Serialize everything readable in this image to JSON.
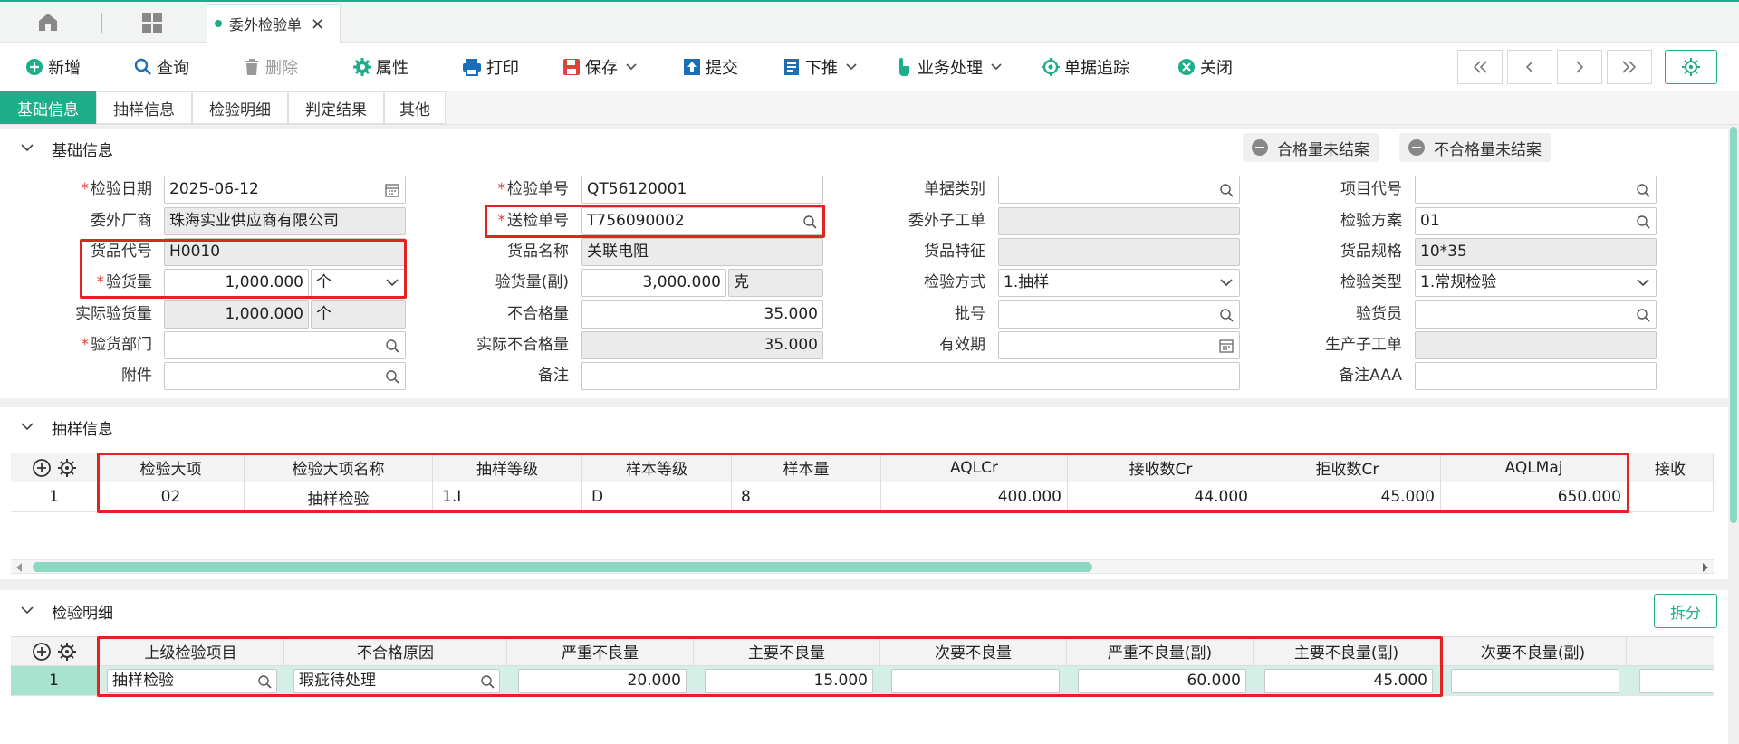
{
  "tabbar": {
    "active_tab": "委外检验单"
  },
  "toolbar": {
    "new": "新增",
    "query": "查询",
    "delete": "删除",
    "property": "属性",
    "print": "打印",
    "save": "保存",
    "submit": "提交",
    "push_down": "下推",
    "business": "业务处理",
    "trace": "单据追踪",
    "close": "关闭"
  },
  "section_tabs": [
    "基础信息",
    "抽样信息",
    "检验明细",
    "判定结果",
    "其他"
  ],
  "basic": {
    "title": "基础信息",
    "pill_qualified": "合格量未结案",
    "pill_unqualified": "不合格量未结案",
    "labels": {
      "insp_date": "检验日期",
      "insp_no": "检验单号",
      "doc_type": "单据类别",
      "project_code": "项目代号",
      "vendor": "委外厂商",
      "send_no": "送检单号",
      "sub_order": "委外子工单",
      "insp_plan": "检验方案",
      "item_code": "货品代号",
      "item_name": "货品名称",
      "item_feature": "货品特征",
      "item_spec": "货品规格",
      "insp_qty": "验货量",
      "insp_qty_sub": "验货量(副)",
      "insp_method": "检验方式",
      "insp_type": "检验类型",
      "actual_qty": "实际验货量",
      "unqual_qty": "不合格量",
      "batch": "批号",
      "inspector": "验货员",
      "insp_dept": "验货部门",
      "actual_unqual": "实际不合格量",
      "valid_period": "有效期",
      "prod_sub_order": "生产子工单",
      "attachment": "附件",
      "remark": "备注",
      "remark_aaa": "备注AAA"
    },
    "values": {
      "insp_date": "2025-06-12",
      "insp_no": "QT56120001",
      "doc_type": "",
      "project_code": "",
      "vendor": "珠海实业供应商有限公司",
      "send_no": "T756090002",
      "sub_order": "",
      "insp_plan": "01",
      "item_code": "H0010",
      "item_name": "关联电阻",
      "item_feature": "",
      "item_spec": "10*35",
      "insp_qty": "1,000.000",
      "insp_unit": "个",
      "insp_qty_sub": "3,000.000",
      "insp_unit_sub": "克",
      "insp_method": "1.抽样",
      "insp_type": "1.常规检验",
      "actual_qty": "1,000.000",
      "actual_unit": "个",
      "unqual_qty": "35.000",
      "batch": "",
      "inspector": "",
      "insp_dept": "",
      "actual_unqual": "35.000",
      "valid_period": "",
      "prod_sub_order": "",
      "attachment": "",
      "remark": "",
      "remark_aaa": ""
    }
  },
  "sampling": {
    "title": "抽样信息",
    "columns": [
      "检验大项",
      "检验大项名称",
      "抽样等级",
      "样本等级",
      "样本量",
      "AQLCr",
      "接收数Cr",
      "拒收数Cr",
      "AQLMaj",
      "接收"
    ],
    "rows": [
      {
        "no": "1",
        "cells": [
          "02",
          "抽样检验",
          "1.I",
          "D",
          "8",
          "400.000",
          "44.000",
          "45.000",
          "650.000",
          ""
        ]
      }
    ]
  },
  "detail": {
    "title": "检验明细",
    "split_label": "拆分",
    "columns": [
      "上级检验项目",
      "不合格原因",
      "严重不良量",
      "主要不良量",
      "次要不良量",
      "严重不良量(副)",
      "主要不良量(副)",
      "次要不良量(副)"
    ],
    "rows": [
      {
        "no": "1",
        "cells": [
          "抽样检验",
          "瑕疵待处理",
          "20.000",
          "15.000",
          "",
          "60.000",
          "45.000",
          ""
        ]
      }
    ]
  },
  "colors": {
    "accent": "#1bae88",
    "highlight": "#e32222",
    "required": "#e0413a"
  }
}
